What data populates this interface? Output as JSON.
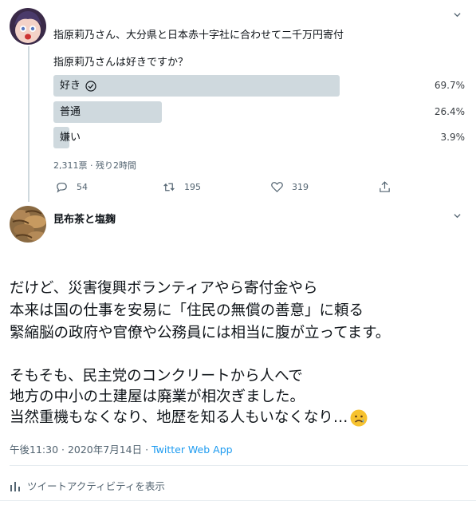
{
  "tweet1": {
    "title": "指原莉乃さん、大分県と日本赤十字社に合わせて二千万円寄付",
    "question": "指原莉乃さんは好きですか？",
    "poll": [
      {
        "label": "好き",
        "percent": "69.7%",
        "value": 69.7,
        "selected": true
      },
      {
        "label": "普通",
        "percent": "26.4%",
        "value": 26.4,
        "selected": false
      },
      {
        "label": "嫌い",
        "percent": "3.9%",
        "value": 3.9,
        "selected": false
      }
    ],
    "meta": "2,311票 · 残り2時間",
    "actions": {
      "replies": "54",
      "retweets": "195",
      "likes": "319"
    }
  },
  "tweet2": {
    "author": "昆布茶と塩麹",
    "body_lines": [
      "だけど、災害復興ボランティアやら寄付金やら",
      "本来は国の仕事を安易に「住民の無償の善意」に頼る",
      "緊縮脳の政府や官僚や公務員には相当に腹が立ってます。",
      "",
      "そもそも、民主党のコンクリートから人へで",
      "地方の中小の土建屋は廃業が相次ぎました。",
      "当然重機もなくなり、地歴を知る人もいなくなり…"
    ],
    "timestamp": "午後11:30 · 2020年7月14日",
    "client": "Twitter Web App",
    "activity_label": "ツイートアクティビティを表示"
  },
  "colors": {
    "poll_bar": "#cfd9de",
    "link": "#1d9bf0",
    "muted": "#536471"
  }
}
